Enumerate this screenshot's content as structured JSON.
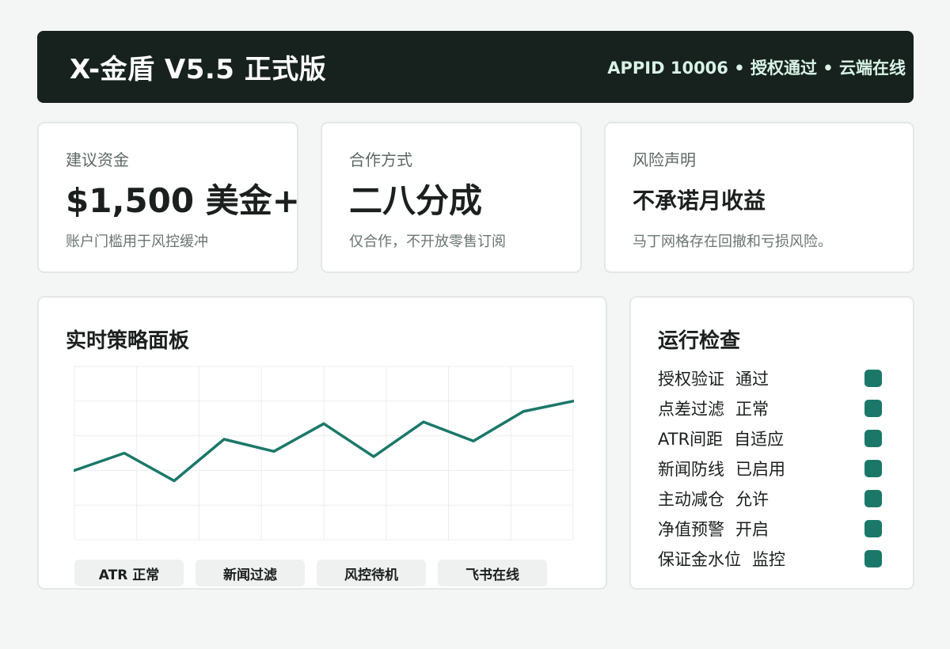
{
  "header": {
    "title": "X-金盾 V5.5 正式版",
    "status": "APPID 10006 • 授权通过 • 云端在线"
  },
  "stats": [
    {
      "label": "建议资金",
      "value": "$1,500 美金+",
      "note": "账户门槛用于风控缓冲"
    },
    {
      "label": "合作方式",
      "value": "二八分成",
      "note": "仅合作，不开放零售订阅"
    },
    {
      "label": "风险声明",
      "value": "不承诺月收益",
      "note": "马丁网格存在回撤和亏损风险。"
    }
  ],
  "panel": {
    "title": "实时策略面板",
    "chips": [
      "ATR 正常",
      "新闻过滤",
      "风控待机",
      "飞书在线"
    ]
  },
  "chart_data": {
    "type": "line",
    "x": [
      0,
      1,
      2,
      3,
      4,
      5,
      6,
      7,
      8,
      9,
      10
    ],
    "series": [
      {
        "values": [
          0.4,
          0.5,
          0.34,
          0.58,
          0.51,
          0.67,
          0.48,
          0.68,
          0.57,
          0.74,
          0.8
        ]
      }
    ],
    "ylim": [
      0,
      1
    ],
    "grid": true,
    "color": "#1b7869"
  },
  "checks": {
    "title": "运行检查",
    "items": [
      {
        "name": "授权验证",
        "value": "通过"
      },
      {
        "name": "点差过滤",
        "value": "正常"
      },
      {
        "name": "ATR间距",
        "value": "自适应"
      },
      {
        "name": "新闻防线",
        "value": "已启用"
      },
      {
        "name": "主动减仓",
        "value": "允许"
      },
      {
        "name": "净值预警",
        "value": "开启"
      },
      {
        "name": "保证金水位",
        "value": "监控"
      }
    ],
    "indicator_color": "#1b7869"
  }
}
